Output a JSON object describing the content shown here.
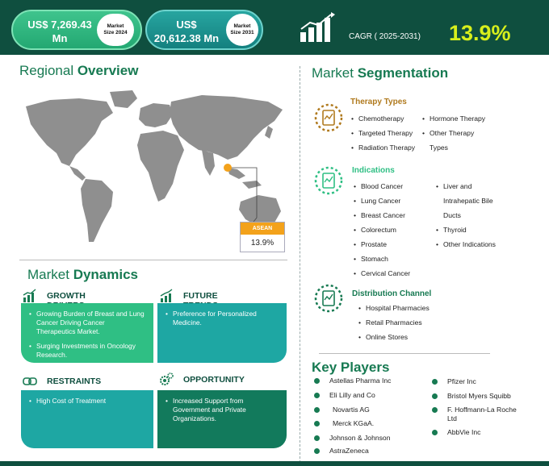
{
  "header": {
    "size_2024_value": "US$ 7,269.43 Mn",
    "size_2024_label_line1": "Market",
    "size_2024_label_line2": "Size 2024",
    "size_2031_value": "US$ 20,612.38 Mn",
    "size_2031_label_line1": "Market",
    "size_2031_label_line2": "Size 2031",
    "cagr_label": "CAGR ( 2025-2031)",
    "cagr_value": "13.9%",
    "colors": {
      "dark_green": "#0f4f3f",
      "accent_green": "#2fbf84",
      "teal": "#1ea7a3",
      "cagr_yellow": "#d7ef1c",
      "asean_orange": "#f3a21b"
    },
    "icon": "growth-bar-chart-icon"
  },
  "regional": {
    "title_part1": "Regional ",
    "title_part2": "Overview",
    "asean_label": "ASEAN",
    "asean_value": "13.9%",
    "map_icon": "world-map"
  },
  "dynamics": {
    "title_part1": "Market ",
    "title_part2": "Dynamics",
    "growth_drivers": {
      "label": "GROWTH DRIVERS",
      "icon": "chart-up-icon",
      "items": [
        "Growing Burden of Breast and Lung Cancer Driving Cancer Therapeutics Market.",
        "Surging Investments in Oncology Research."
      ]
    },
    "future_trends": {
      "label": "FUTURE TRENDS",
      "icon": "trend-chart-icon",
      "items": [
        "Preference for Personalized Medicine."
      ]
    },
    "restraints": {
      "label": "RESTRAINTS",
      "icon": "chain-link-icon",
      "items": [
        "High Cost of Treatment"
      ]
    },
    "opportunity": {
      "label": "OPPORTUNITY",
      "icon": "gears-icon",
      "items": [
        "Increased Support from Government and Private Organizations."
      ]
    }
  },
  "segmentation": {
    "title_part1": "Market ",
    "title_part2": "Segmentation",
    "therapy_types": {
      "title": "Therapy Types",
      "color": "#b07a1e",
      "items": [
        "Chemotherapy",
        "Targeted Therapy",
        "Radiation Therapy",
        "Hormone Therapy",
        "Other Therapy",
        "Types"
      ]
    },
    "indications": {
      "title": "Indications",
      "color": "#2fbf84",
      "items": [
        "Blood Cancer",
        "Lung Cancer",
        "Breast Cancer",
        "Colorectum",
        "Prostate",
        "Stomach",
        "Cervical Cancer",
        "Liver and",
        "Intrahepatic Bile",
        "Ducts",
        "Thyroid",
        "Other Indications"
      ]
    },
    "distribution": {
      "title": "Distribution Channel",
      "color": "#177a52",
      "items": [
        "Hospital Pharmacies",
        "Retail Pharmacies",
        "Online Stores"
      ]
    }
  },
  "key_players": {
    "title": "Key Players",
    "items": [
      "Astellas Pharma Inc",
      "Eli Lilly and Co",
      "Novartis AG",
      "Merck KGaA.",
      "Johnson & Johnson",
      "AstraZeneca",
      "Pfizer Inc",
      "Bristol Myers Squibb",
      "F. Hoffmann-La Roche",
      "Ltd",
      "AbbVie Inc"
    ]
  }
}
